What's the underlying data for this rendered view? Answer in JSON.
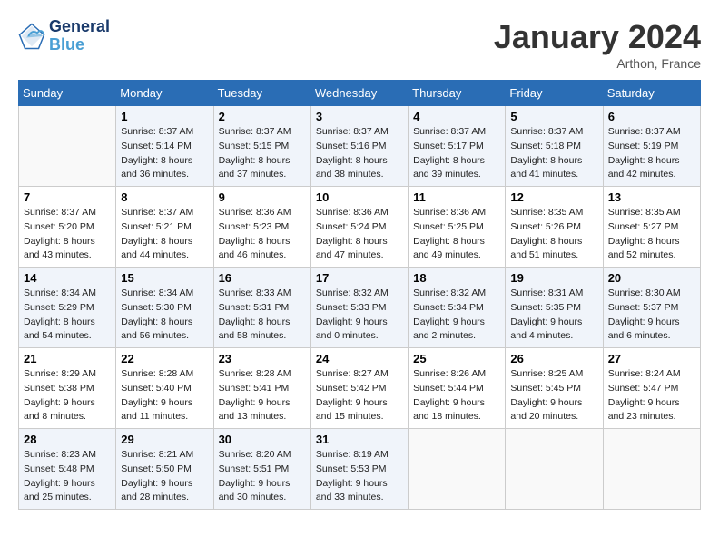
{
  "header": {
    "logo_line1": "General",
    "logo_line2": "Blue",
    "month": "January 2024",
    "location": "Arthon, France"
  },
  "weekdays": [
    "Sunday",
    "Monday",
    "Tuesday",
    "Wednesday",
    "Thursday",
    "Friday",
    "Saturday"
  ],
  "weeks": [
    [
      {
        "day": "",
        "sunrise": "",
        "sunset": "",
        "daylight": ""
      },
      {
        "day": "1",
        "sunrise": "Sunrise: 8:37 AM",
        "sunset": "Sunset: 5:14 PM",
        "daylight": "Daylight: 8 hours and 36 minutes."
      },
      {
        "day": "2",
        "sunrise": "Sunrise: 8:37 AM",
        "sunset": "Sunset: 5:15 PM",
        "daylight": "Daylight: 8 hours and 37 minutes."
      },
      {
        "day": "3",
        "sunrise": "Sunrise: 8:37 AM",
        "sunset": "Sunset: 5:16 PM",
        "daylight": "Daylight: 8 hours and 38 minutes."
      },
      {
        "day": "4",
        "sunrise": "Sunrise: 8:37 AM",
        "sunset": "Sunset: 5:17 PM",
        "daylight": "Daylight: 8 hours and 39 minutes."
      },
      {
        "day": "5",
        "sunrise": "Sunrise: 8:37 AM",
        "sunset": "Sunset: 5:18 PM",
        "daylight": "Daylight: 8 hours and 41 minutes."
      },
      {
        "day": "6",
        "sunrise": "Sunrise: 8:37 AM",
        "sunset": "Sunset: 5:19 PM",
        "daylight": "Daylight: 8 hours and 42 minutes."
      }
    ],
    [
      {
        "day": "7",
        "sunrise": "Sunrise: 8:37 AM",
        "sunset": "Sunset: 5:20 PM",
        "daylight": "Daylight: 8 hours and 43 minutes."
      },
      {
        "day": "8",
        "sunrise": "Sunrise: 8:37 AM",
        "sunset": "Sunset: 5:21 PM",
        "daylight": "Daylight: 8 hours and 44 minutes."
      },
      {
        "day": "9",
        "sunrise": "Sunrise: 8:36 AM",
        "sunset": "Sunset: 5:23 PM",
        "daylight": "Daylight: 8 hours and 46 minutes."
      },
      {
        "day": "10",
        "sunrise": "Sunrise: 8:36 AM",
        "sunset": "Sunset: 5:24 PM",
        "daylight": "Daylight: 8 hours and 47 minutes."
      },
      {
        "day": "11",
        "sunrise": "Sunrise: 8:36 AM",
        "sunset": "Sunset: 5:25 PM",
        "daylight": "Daylight: 8 hours and 49 minutes."
      },
      {
        "day": "12",
        "sunrise": "Sunrise: 8:35 AM",
        "sunset": "Sunset: 5:26 PM",
        "daylight": "Daylight: 8 hours and 51 minutes."
      },
      {
        "day": "13",
        "sunrise": "Sunrise: 8:35 AM",
        "sunset": "Sunset: 5:27 PM",
        "daylight": "Daylight: 8 hours and 52 minutes."
      }
    ],
    [
      {
        "day": "14",
        "sunrise": "Sunrise: 8:34 AM",
        "sunset": "Sunset: 5:29 PM",
        "daylight": "Daylight: 8 hours and 54 minutes."
      },
      {
        "day": "15",
        "sunrise": "Sunrise: 8:34 AM",
        "sunset": "Sunset: 5:30 PM",
        "daylight": "Daylight: 8 hours and 56 minutes."
      },
      {
        "day": "16",
        "sunrise": "Sunrise: 8:33 AM",
        "sunset": "Sunset: 5:31 PM",
        "daylight": "Daylight: 8 hours and 58 minutes."
      },
      {
        "day": "17",
        "sunrise": "Sunrise: 8:32 AM",
        "sunset": "Sunset: 5:33 PM",
        "daylight": "Daylight: 9 hours and 0 minutes."
      },
      {
        "day": "18",
        "sunrise": "Sunrise: 8:32 AM",
        "sunset": "Sunset: 5:34 PM",
        "daylight": "Daylight: 9 hours and 2 minutes."
      },
      {
        "day": "19",
        "sunrise": "Sunrise: 8:31 AM",
        "sunset": "Sunset: 5:35 PM",
        "daylight": "Daylight: 9 hours and 4 minutes."
      },
      {
        "day": "20",
        "sunrise": "Sunrise: 8:30 AM",
        "sunset": "Sunset: 5:37 PM",
        "daylight": "Daylight: 9 hours and 6 minutes."
      }
    ],
    [
      {
        "day": "21",
        "sunrise": "Sunrise: 8:29 AM",
        "sunset": "Sunset: 5:38 PM",
        "daylight": "Daylight: 9 hours and 8 minutes."
      },
      {
        "day": "22",
        "sunrise": "Sunrise: 8:28 AM",
        "sunset": "Sunset: 5:40 PM",
        "daylight": "Daylight: 9 hours and 11 minutes."
      },
      {
        "day": "23",
        "sunrise": "Sunrise: 8:28 AM",
        "sunset": "Sunset: 5:41 PM",
        "daylight": "Daylight: 9 hours and 13 minutes."
      },
      {
        "day": "24",
        "sunrise": "Sunrise: 8:27 AM",
        "sunset": "Sunset: 5:42 PM",
        "daylight": "Daylight: 9 hours and 15 minutes."
      },
      {
        "day": "25",
        "sunrise": "Sunrise: 8:26 AM",
        "sunset": "Sunset: 5:44 PM",
        "daylight": "Daylight: 9 hours and 18 minutes."
      },
      {
        "day": "26",
        "sunrise": "Sunrise: 8:25 AM",
        "sunset": "Sunset: 5:45 PM",
        "daylight": "Daylight: 9 hours and 20 minutes."
      },
      {
        "day": "27",
        "sunrise": "Sunrise: 8:24 AM",
        "sunset": "Sunset: 5:47 PM",
        "daylight": "Daylight: 9 hours and 23 minutes."
      }
    ],
    [
      {
        "day": "28",
        "sunrise": "Sunrise: 8:23 AM",
        "sunset": "Sunset: 5:48 PM",
        "daylight": "Daylight: 9 hours and 25 minutes."
      },
      {
        "day": "29",
        "sunrise": "Sunrise: 8:21 AM",
        "sunset": "Sunset: 5:50 PM",
        "daylight": "Daylight: 9 hours and 28 minutes."
      },
      {
        "day": "30",
        "sunrise": "Sunrise: 8:20 AM",
        "sunset": "Sunset: 5:51 PM",
        "daylight": "Daylight: 9 hours and 30 minutes."
      },
      {
        "day": "31",
        "sunrise": "Sunrise: 8:19 AM",
        "sunset": "Sunset: 5:53 PM",
        "daylight": "Daylight: 9 hours and 33 minutes."
      },
      {
        "day": "",
        "sunrise": "",
        "sunset": "",
        "daylight": ""
      },
      {
        "day": "",
        "sunrise": "",
        "sunset": "",
        "daylight": ""
      },
      {
        "day": "",
        "sunrise": "",
        "sunset": "",
        "daylight": ""
      }
    ]
  ]
}
